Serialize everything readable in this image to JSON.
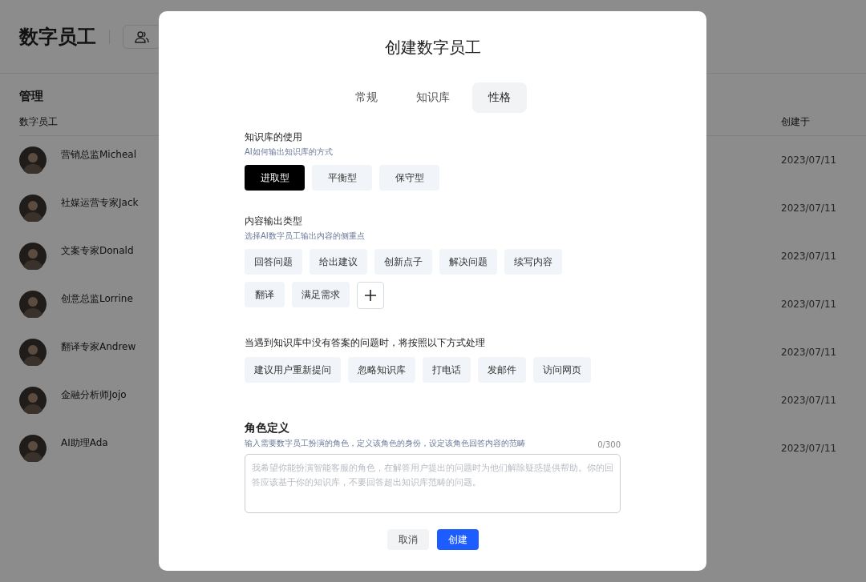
{
  "page": {
    "title": "数字员工",
    "section": "管理",
    "columns": [
      "数字员工",
      "创建于"
    ],
    "rows": [
      {
        "name": "营销总监Micheal",
        "created": "2023/07/11"
      },
      {
        "name": "社媒运营专家Jack",
        "created": "2023/07/11"
      },
      {
        "name": "文案专家Donald",
        "created": "2023/07/11"
      },
      {
        "name": "创意总监Lorrine",
        "created": "2023/07/11"
      },
      {
        "name": "翻译专家Andrew",
        "created": "2023/07/11"
      },
      {
        "name": "金融分析师Jojo",
        "created": "2023/07/11"
      },
      {
        "name": "AI助理Ada",
        "created": "2023/07/11"
      }
    ]
  },
  "dialog": {
    "title": "创建数字员工",
    "tabs": [
      {
        "label": "常规",
        "selected": false
      },
      {
        "label": "知识库",
        "selected": false
      },
      {
        "label": "性格",
        "selected": true
      }
    ],
    "groups": [
      {
        "title": "知识库的使用",
        "hint": "AI如何输出知识库的方式",
        "options": [
          {
            "label": "进取型",
            "selected": true
          },
          {
            "label": "平衡型",
            "selected": false
          },
          {
            "label": "保守型",
            "selected": false
          }
        ],
        "add": false
      },
      {
        "title": "内容输出类型",
        "hint": "选择AI数字员工输出内容的侧重点",
        "options": [
          {
            "label": "回答问题",
            "selected": false
          },
          {
            "label": "给出建议",
            "selected": false
          },
          {
            "label": "创新点子",
            "selected": false
          },
          {
            "label": "解决问题",
            "selected": false
          },
          {
            "label": "续写内容",
            "selected": false
          },
          {
            "label": "翻译",
            "selected": false
          },
          {
            "label": "满足需求",
            "selected": false
          }
        ],
        "add": true
      },
      {
        "title": "当遇到知识库中没有答案的问题时，将按照以下方式处理",
        "options": [
          {
            "label": "建议用户重新提问",
            "selected": false
          },
          {
            "label": "忽略知识库",
            "selected": false
          },
          {
            "label": "打电话",
            "selected": false
          },
          {
            "label": "发邮件",
            "selected": false
          },
          {
            "label": "访问网页",
            "selected": false
          }
        ],
        "add": false
      }
    ],
    "role": {
      "title": "角色定义",
      "hint": "输入需要数字员工扮演的角色，定义该角色的身份，设定该角色回答内容的范畴",
      "counter": "0/300",
      "placeholder": "我希望你能扮演智能客服的角色，在解答用户提出的问题时为他们解除疑惑提供帮助。你的回答应该基于你的知识库，不要回答超出知识库范畴的问题。"
    },
    "buttons": [
      {
        "label": "取消",
        "kind": "secondary"
      },
      {
        "label": "创建",
        "kind": "primary"
      }
    ]
  }
}
